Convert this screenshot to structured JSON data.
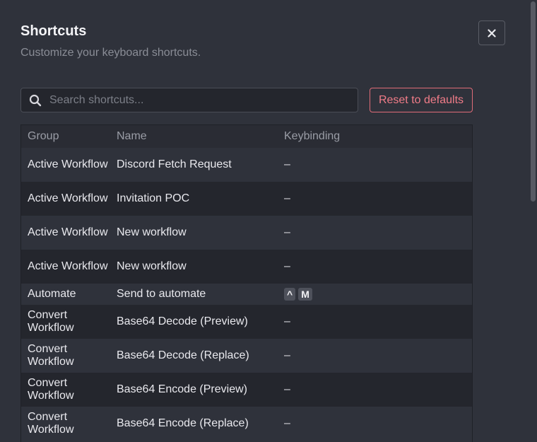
{
  "dialog": {
    "title": "Shortcuts",
    "subtitle": "Customize your keyboard shortcuts."
  },
  "icons": {
    "close": "close-icon",
    "search": "search-icon"
  },
  "search": {
    "placeholder": "Search shortcuts...",
    "value": ""
  },
  "reset_button": {
    "label": "Reset to defaults"
  },
  "colors": {
    "background": "#2f323b",
    "row_alt": "#24262d",
    "accent_danger": "#f07c88"
  },
  "table": {
    "columns": [
      "Group",
      "Name",
      "Keybinding"
    ],
    "rows": [
      {
        "group": "Active Workflow",
        "name": "Discord Fetch Request",
        "keybinding": "–",
        "keys": []
      },
      {
        "group": "Active Workflow",
        "name": "Invitation POC",
        "keybinding": "–",
        "keys": []
      },
      {
        "group": "Active Workflow",
        "name": "New workflow",
        "keybinding": "–",
        "keys": []
      },
      {
        "group": "Active Workflow",
        "name": "New workflow",
        "keybinding": "–",
        "keys": []
      },
      {
        "group": "Automate",
        "name": "Send to automate",
        "keybinding": "",
        "keys": [
          "^",
          "M"
        ]
      },
      {
        "group": "Convert Workflow",
        "name": "Base64 Decode (Preview)",
        "keybinding": "–",
        "keys": []
      },
      {
        "group": "Convert Workflow",
        "name": "Base64 Decode (Replace)",
        "keybinding": "–",
        "keys": []
      },
      {
        "group": "Convert Workflow",
        "name": "Base64 Encode (Preview)",
        "keybinding": "–",
        "keys": []
      },
      {
        "group": "Convert Workflow",
        "name": "Base64 Encode (Replace)",
        "keybinding": "–",
        "keys": []
      }
    ]
  }
}
